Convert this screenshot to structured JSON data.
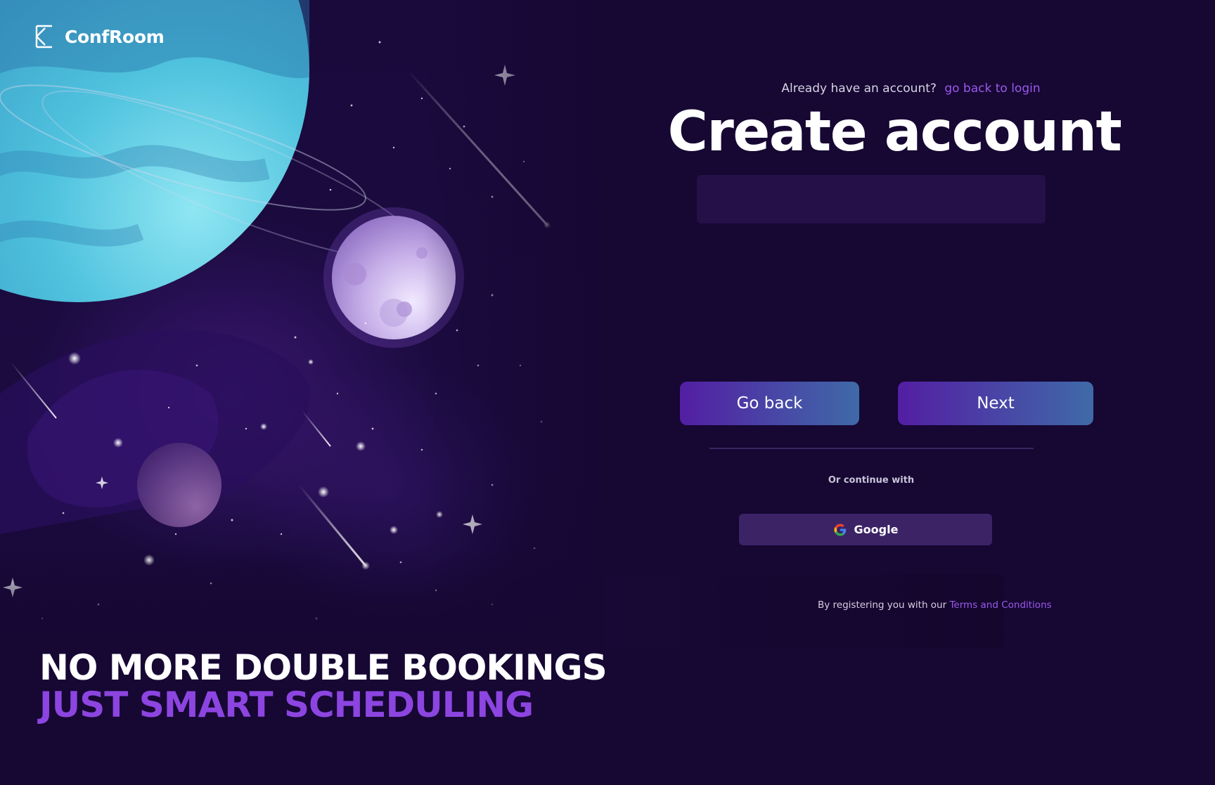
{
  "brand": {
    "name": "ConfRoom",
    "logo_icon": "confroom-logo-icon"
  },
  "hero": {
    "line1": "NO MORE DOUBLE BOOKINGS",
    "line2": "JUST SMART SCHEDULING"
  },
  "auth": {
    "login_prompt": "Already have an account?",
    "login_link": "go back to login",
    "title": "Create account",
    "input_value": "",
    "back_label": "Go back",
    "next_label": "Next",
    "or_continue": "Or continue with",
    "google_label": "Google",
    "google_icon": "google-icon",
    "terms_prefix": "By registering you with our",
    "terms_link": "Terms and Conditions"
  },
  "colors": {
    "background": "#160733",
    "accent": "#9b59ec",
    "tagline_accent": "#8c45e0",
    "button_gradient_start": "#531ea3",
    "button_gradient_end": "#3f6aa8",
    "input_bg": "#261048",
    "google_button_bg": "#3c2366"
  }
}
